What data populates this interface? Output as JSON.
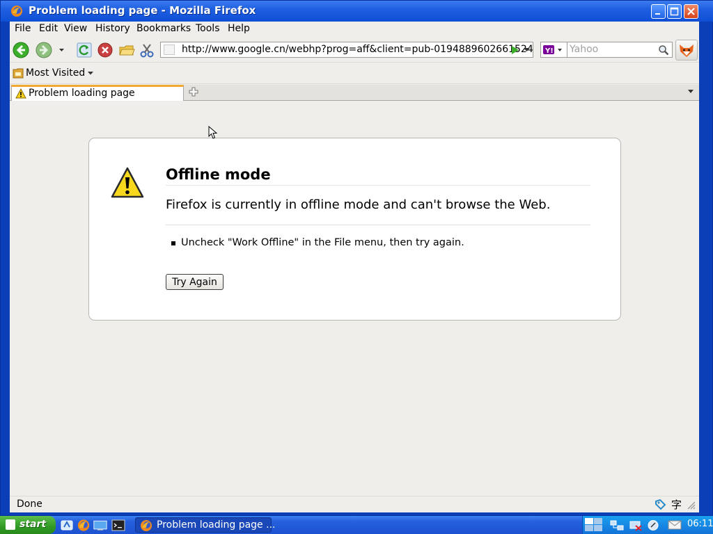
{
  "window": {
    "title": "Problem loading page - Mozilla Firefox"
  },
  "menubar": {
    "items": [
      {
        "label": "File"
      },
      {
        "label": "Edit"
      },
      {
        "label": "View"
      },
      {
        "label": "History"
      },
      {
        "label": "Bookmarks"
      },
      {
        "label": "Tools"
      },
      {
        "label": "Help"
      }
    ]
  },
  "navbar": {
    "url": "http://www.google.cn/webhp?prog=aff&client=pub-0194889602661524",
    "search_placeholder": "Yahoo"
  },
  "bookmarks": {
    "most_visited": "Most Visited"
  },
  "tab": {
    "label": "Problem loading page"
  },
  "error": {
    "title": "Offline mode",
    "description": "Firefox is currently in offline mode and can't browse the Web.",
    "hint": "Uncheck \"Work Offline\" in the File menu, then try again.",
    "button": "Try Again"
  },
  "status": {
    "text": "Done",
    "ime_char": "字"
  },
  "taskbar": {
    "start_label": "start",
    "task_label": "Problem loading page ...",
    "clock": "06:11"
  },
  "colors": {
    "titlebar": "#1f5fe0",
    "taskbar": "#2660dc",
    "start": "#2f9a24",
    "tab_accent": "#f0a830"
  }
}
